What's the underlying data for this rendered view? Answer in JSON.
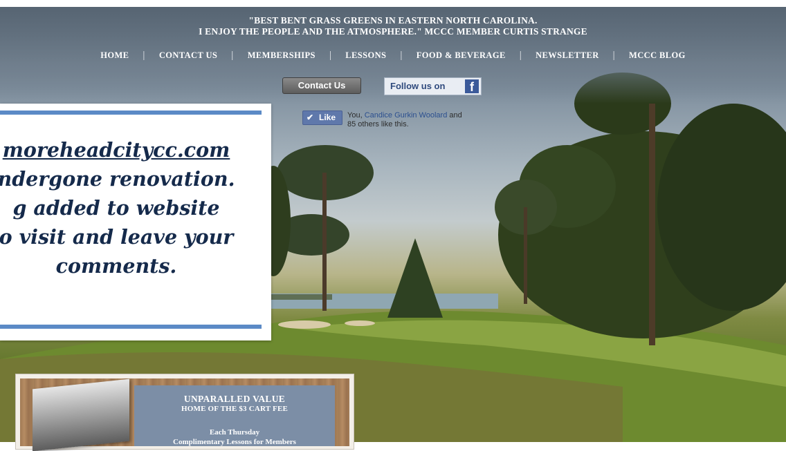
{
  "header": {
    "quote_line1": "\"BEST BENT GRASS GREENS IN EASTERN NORTH CAROLINA.",
    "quote_line2": "I ENJOY THE PEOPLE AND THE ATMOSPHERE.\"  MCCC MEMBER CURTIS STRANGE"
  },
  "nav": {
    "items": [
      {
        "label": "HOME"
      },
      {
        "label": "CONTACT US"
      },
      {
        "label": "MEMBERSHIPS"
      },
      {
        "label": "LESSONS"
      },
      {
        "label": "FOOD & BEVERAGE"
      },
      {
        "label": "NEWSLETTER"
      },
      {
        "label": "MCCC BLOG"
      }
    ],
    "separator": "|"
  },
  "buttons": {
    "contact_label": "Contact Us",
    "follow_label": "Follow us on",
    "fb_glyph": "f"
  },
  "like": {
    "button_label": "Like",
    "check_glyph": "✔",
    "text_prefix": "You, ",
    "friend_name": "Candice Gurkin Woolard",
    "text_suffix": " and",
    "text_line2": "85 others like this."
  },
  "announcement": {
    "line1_url": "moreheadcitycc.com",
    "line2": "ndergone renovation.",
    "line3": "g added to website",
    "line4": "o visit and leave your",
    "line5": "comments."
  },
  "promo": {
    "title": "UNPARALLED VALUE",
    "subtitle": "HOME OF THE $3 CART FEE",
    "line1": "Each Thursday",
    "line2": "Complimentary Lessons for Members"
  },
  "colors": {
    "accent_bar": "#5b8ac6",
    "announce_text": "#152a4b",
    "facebook_blue": "#3b5a9a",
    "promo_panel": "#7c8ea6"
  }
}
